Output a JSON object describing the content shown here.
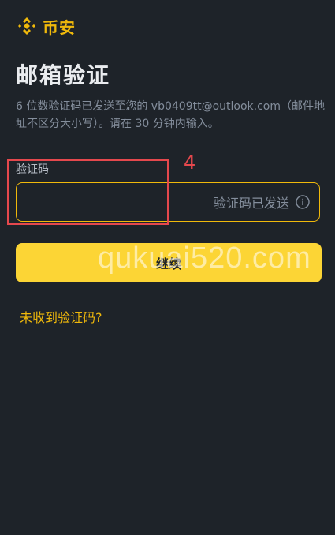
{
  "brand": {
    "name": "币安",
    "color": "#f0b90b",
    "logo_icon": "binance-diamond-logo"
  },
  "page": {
    "title": "邮箱验证",
    "description": "6 位数验证码已发送至您的 vb0409tt@outlook.com（邮件地址不区分大小写）。请在 30 分钟内输入。"
  },
  "code_field": {
    "label": "验证码",
    "value": "",
    "status_text": "验证码已发送",
    "status_icon": "info-circle-icon"
  },
  "annotation": {
    "number": "4",
    "color": "#e5484d"
  },
  "continue_button": {
    "label": "继续",
    "color": "#fcd535"
  },
  "watermark_text": "qukuai520.com",
  "resend_link": "未收到验证码?"
}
